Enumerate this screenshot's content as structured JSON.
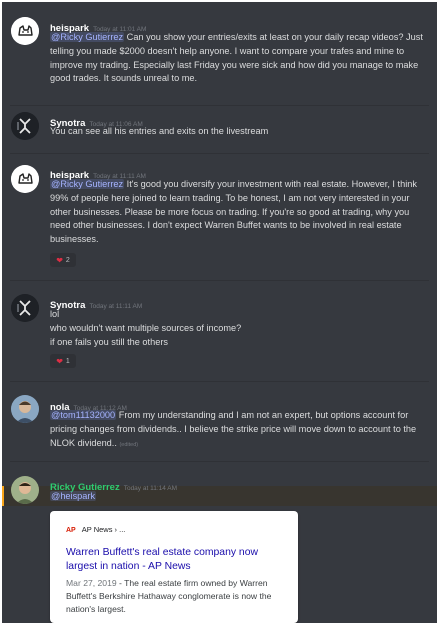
{
  "messages": [
    {
      "username": "heispark",
      "timestamp": "Today at 11:01 AM",
      "mention": "@Ricky Gutierrez",
      "text": " Can you show your entries/exits at least on your daily recap videos? Just telling you made $2000 doesn't help anyone. I want to compare your trafes and mine to improve my trading. Especially last Friday you were sick and how did you manage to make good trades. It sounds unreal to me."
    },
    {
      "username": "Synotra",
      "timestamp": "Today at 11:06 AM",
      "text": "You can see all his entries and exits on the livestream"
    },
    {
      "username": "heispark",
      "timestamp": "Today at 11:11 AM",
      "mention": "@Ricky Gutierrez",
      "text": " It's good you diversify your investment with real estate. However, I think 99% of people here joined to learn trading. To be honest, I am not very interested in your other businesses. Please be more focus on trading. If you're so good at trading, why you need other businesses. I don't expect Warren Buffet wants to be involved in real estate businesses.",
      "reaction": {
        "icon": "heart-icon",
        "count": "2"
      }
    },
    {
      "username": "Synotra",
      "timestamp": "Today at 11:11 AM",
      "lines": [
        "lol",
        "who wouldn't want multiple sources of income?",
        "if one fails you still the others"
      ],
      "reaction": {
        "icon": "heart-icon",
        "count": "1"
      }
    },
    {
      "username": "nola",
      "timestamp": "Today at 11:12 AM",
      "mention": "@tom11132000",
      "text": " From my understanding and I am not an expert, but options account for pricing changes from dividends.. I believe the strike price will move down to account to the NLOK dividend.. ",
      "edited": "(edited)"
    },
    {
      "username": "Ricky Gutierrez",
      "username_color": "#2ecc71",
      "timestamp": "Today at 11:14 AM",
      "mention": "@heispark",
      "embed": {
        "logo": "AP",
        "source": "AP News › ...",
        "title": "Warren Buffett's real estate company now largest in nation - AP News",
        "date": "Mar 27, 2019",
        "description": " - The real estate firm owned by Warren Buffett's Berkshire Hathaway conglomerate is now the nation's largest."
      }
    }
  ],
  "colors": {
    "background": "#36393f",
    "text": "#dcddde",
    "mention": "#a5b3ff",
    "timestamp": "#72767d",
    "highlight_accent": "#faa61a",
    "link": "#1a0dab"
  }
}
